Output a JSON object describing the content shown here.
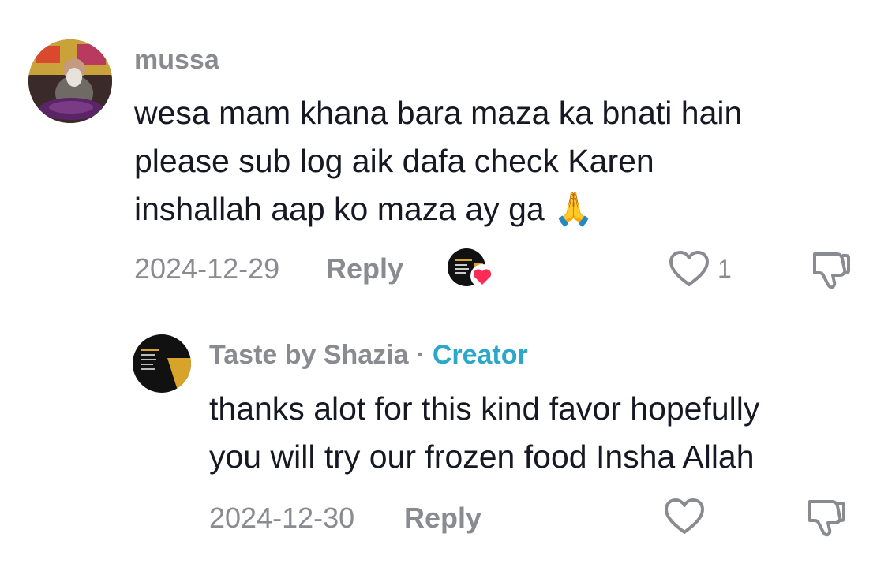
{
  "comments": [
    {
      "username": "mussa",
      "lines": [
        "wesa mam khana bara maza ka bnati hain",
        "please sub log aik dafa check Karen",
        "inshallah aap ko maza ay ga"
      ],
      "emoji": "🙏",
      "date": "2024-12-29",
      "reply_label": "Reply",
      "like_count": "1"
    },
    {
      "username": "Taste by Shazia",
      "separator": "·",
      "creator_label": "Creator",
      "lines": [
        "thanks alot for this kind favor hopefully",
        "you will try our frozen food Insha Allah"
      ],
      "date": "2024-12-30",
      "reply_label": "Reply"
    }
  ],
  "colors": {
    "muted": "#8a8b91",
    "creator": "#2aa7c9",
    "liked_heart_badge": "#fe2c55"
  },
  "icons": {
    "like": "heart-outline-icon",
    "dislike": "thumbs-down-icon",
    "creator_liked": "creator-liked-badge"
  }
}
